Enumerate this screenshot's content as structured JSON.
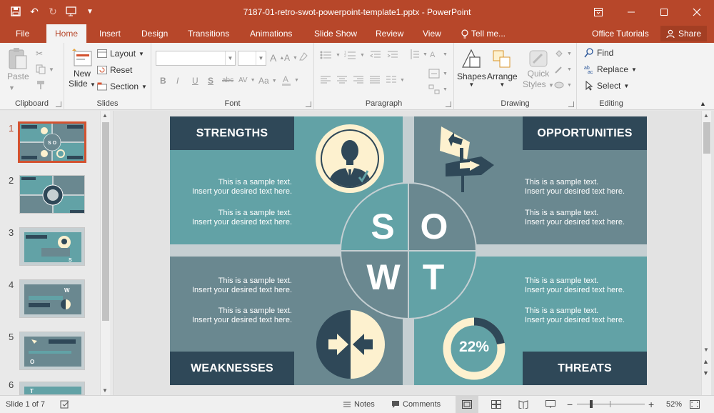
{
  "window": {
    "title": "7187-01-retro-swot-powerpoint-template1.pptx - PowerPoint",
    "qat": {
      "save_icon": "save-icon",
      "undo_icon": "undo-icon",
      "redo_icon": "redo-icon",
      "customize_icon": "customize-qat-icon"
    }
  },
  "tabs": [
    "File",
    "Home",
    "Insert",
    "Design",
    "Transitions",
    "Animations",
    "Slide Show",
    "Review",
    "View"
  ],
  "active_tab": "Home",
  "tell_me": "Tell me...",
  "account": "Office Tutorials",
  "share": "Share",
  "ribbon": {
    "clipboard": {
      "label": "Clipboard",
      "paste": "Paste"
    },
    "slides": {
      "label": "Slides",
      "new_slide": "New",
      "new_slide_2": "Slide",
      "layout": "Layout",
      "reset": "Reset",
      "section": "Section"
    },
    "font": {
      "label": "Font",
      "bold": "B",
      "italic": "I",
      "underline": "U",
      "shadow": "S",
      "strike": "abc",
      "spacing": "AV",
      "case": "Aa",
      "grow": "A",
      "shrink": "A"
    },
    "paragraph": {
      "label": "Paragraph"
    },
    "drawing": {
      "label": "Drawing",
      "shapes": "Shapes",
      "arrange": "Arrange",
      "quick_styles": "Quick",
      "quick_styles_2": "Styles"
    },
    "editing": {
      "label": "Editing",
      "find": "Find",
      "replace": "Replace",
      "select": "Select"
    }
  },
  "thumbnails": {
    "numbers": [
      "1",
      "2",
      "3",
      "4",
      "5",
      "6"
    ],
    "active": "1"
  },
  "slide": {
    "strengths": "STRENGTHS",
    "opportunities": "OPPORTUNITIES",
    "weaknesses": "WEAKNESSES",
    "threats": "THREATS",
    "s": "S",
    "o": "O",
    "w": "W",
    "t": "T",
    "percent": "22%",
    "percent_value": 0.22,
    "sample_line1": "This is a sample text.",
    "sample_line2": "Insert your desired text here.",
    "colors": {
      "teal": "#62a2a6",
      "slate": "#6a8890",
      "navy": "#2f4858",
      "cream": "#fdf1cf",
      "band": "#c5cfd2"
    }
  },
  "status": {
    "slide_info": "Slide 1 of 7",
    "notes": "Notes",
    "comments": "Comments",
    "zoom": "52%"
  }
}
